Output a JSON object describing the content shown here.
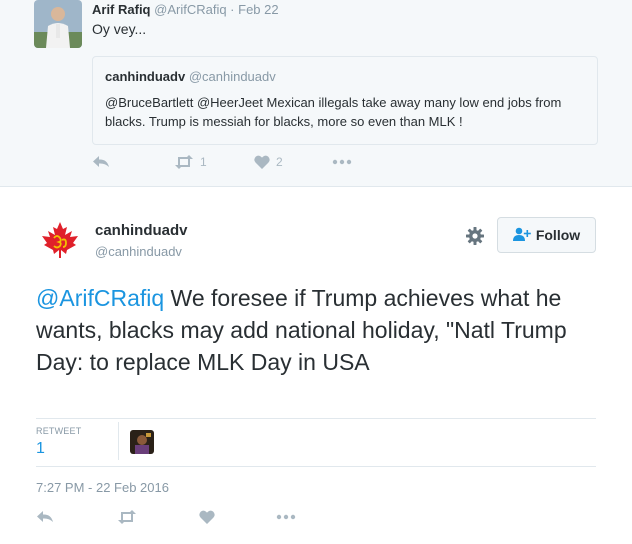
{
  "quoted_tweet": {
    "author_name": "Arif Rafiq",
    "author_handle": "@ArifCRafiq",
    "date_sep": " · ",
    "date": "Feb 22",
    "text": "Oy vey...",
    "quote": {
      "author_name": "canhinduadv",
      "author_handle": "@canhinduadv",
      "text": "@BruceBartlett @HeerJeet Mexican illegals take away many low end jobs from blacks. Trump is messiah for blacks, more so even than MLK !"
    },
    "actions": {
      "reply_icon": "reply-icon",
      "retweet_icon": "retweet-icon",
      "retweet_count": "1",
      "like_icon": "heart-icon",
      "like_count": "2",
      "more_icon": "more-icon"
    }
  },
  "main_tweet": {
    "author_name": "canhinduadv",
    "author_handle": "@canhinduadv",
    "follow_label": "Follow",
    "mention": "@ArifCRafiq",
    "text": " We foresee if Trump achieves what he wants, blacks may add national holiday, \"Natl Trump Day: to replace MLK Day in USA",
    "stats": {
      "retweet_label": "RETWEET",
      "retweet_count": "1"
    },
    "timestamp": "7:27 PM - 22 Feb 2016"
  },
  "colors": {
    "link": "#1b95e0",
    "muted": "#8899a6",
    "icon": "#aab8c2",
    "text": "#292f33",
    "logo_red": "#e0202a"
  }
}
